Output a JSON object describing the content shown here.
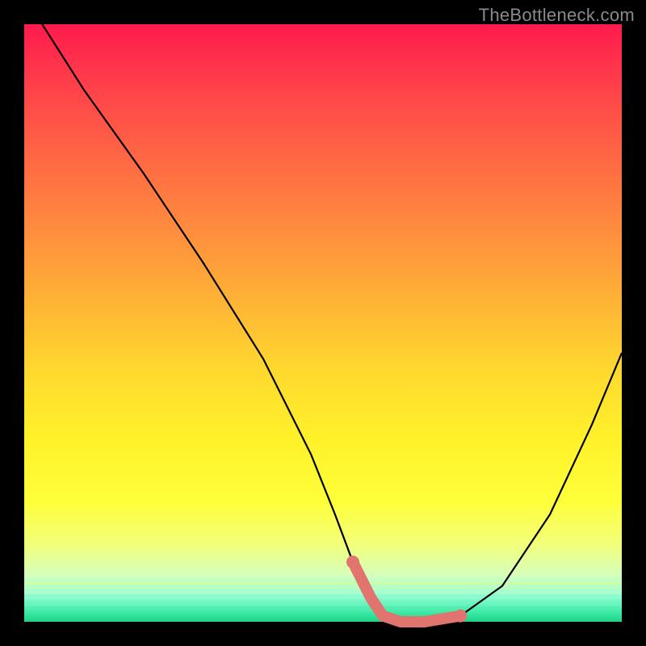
{
  "watermark": "TheBottleneck.com",
  "colors": {
    "frame": "#000000",
    "curve": "#000000",
    "highlight": "#e2746f"
  },
  "chart_data": {
    "type": "line",
    "title": "",
    "xlabel": "",
    "ylabel": "",
    "xlim": [
      0,
      100
    ],
    "ylim": [
      0,
      100
    ],
    "grid": false,
    "legend": false,
    "series": [
      {
        "name": "bottleneck-curve",
        "x": [
          3,
          10,
          20,
          30,
          40,
          48,
          52,
          55,
          58,
          60,
          63,
          67,
          73,
          80,
          88,
          95,
          100
        ],
        "y": [
          100,
          89,
          75,
          60,
          44,
          28,
          18,
          10,
          4,
          1,
          0,
          0,
          1,
          6,
          18,
          33,
          45
        ]
      }
    ],
    "highlight_region": {
      "comment": "thick salmon overlay near trough",
      "x": [
        55,
        58,
        60,
        63,
        67,
        73
      ],
      "y": [
        10,
        4,
        1,
        0,
        0,
        1
      ]
    }
  }
}
